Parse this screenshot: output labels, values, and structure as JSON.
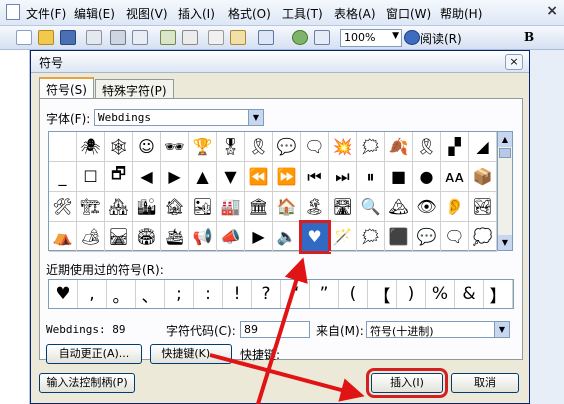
{
  "menubar": {
    "items": [
      "文件(F)",
      "编辑(E)",
      "视图(V)",
      "插入(I)",
      "格式(O)",
      "工具(T)",
      "表格(A)",
      "窗口(W)",
      "帮助(H)"
    ],
    "close_symbol": "×"
  },
  "toolbar": {
    "zoom": "100%",
    "read_label": "阅读(R)",
    "bold_label": "B"
  },
  "dialog": {
    "title": "符号",
    "close_symbol": "×",
    "tabs": [
      "符号(S)",
      "特殊字符(P)"
    ],
    "font_label": "字体(F):",
    "font_value": "Webdings",
    "recent_label": "近期使用过的符号(R):",
    "status_font": "Webdings: 89",
    "charcode_label": "字符代码(C):",
    "charcode_value": "89",
    "from_label": "来自(M):",
    "from_value": "符号(十进制)",
    "autocorrect_button": "自动更正(A)...",
    "shortcut_button": "快捷键(K)...",
    "shortcut_label": "快捷键:",
    "ime_button": "输入法控制柄(P)",
    "insert_button": "插入(I)",
    "cancel_button": "取消"
  },
  "symbols": {
    "rows": [
      [
        "",
        "🕷",
        "🕸",
        "☺",
        "🕶",
        "🏆",
        "🎖",
        "🎗",
        "💬",
        "🗨",
        "💥",
        "🗯",
        "🍂",
        "🎗",
        "▞",
        "◢"
      ],
      [
        "_",
        "☐",
        "🗗",
        "◀",
        "▶",
        "▲",
        "▼",
        "⏪",
        "⏩",
        "⏮",
        "⏭",
        "⏸",
        "■",
        "●",
        "ᴀᴀ",
        "📦"
      ],
      [
        "🛠",
        "🏗",
        "🏘",
        "🏙",
        "🏚",
        "🏜",
        "🏭",
        "🏛",
        "🏠",
        "🏝",
        "🛣",
        "🔍",
        "🏔",
        "👁",
        "👂",
        "🏞"
      ],
      [
        "⛺",
        "🏕",
        "🛤",
        "🏟",
        "🛳",
        "📢",
        "📣",
        "▶",
        "🔈",
        "♥",
        "🪄",
        "🗯",
        "⬛",
        "💬",
        "🗨",
        "💭"
      ]
    ],
    "selected_row": 3,
    "selected_col": 9
  },
  "recent_symbols": [
    "♥",
    ",",
    "。",
    "、",
    ";",
    ":",
    "!",
    "?",
    "“",
    "”",
    "(",
    "【",
    ")",
    "%",
    "&",
    "】"
  ]
}
